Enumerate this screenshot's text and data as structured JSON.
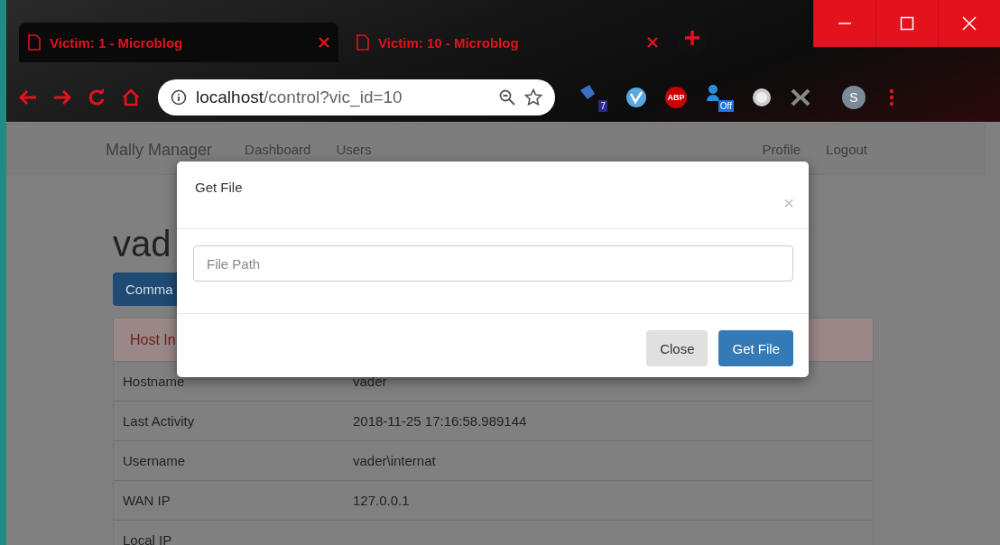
{
  "browser": {
    "tabs": [
      {
        "title": "Victim: 1 - Microblog",
        "selected": false
      },
      {
        "title": "Victim: 10 - Microblog",
        "selected": true
      }
    ],
    "url_host": "localhost",
    "url_path": "/control?vic_id=10",
    "extensions": [
      {
        "kind": "badge",
        "badge": "7"
      },
      {
        "kind": "v"
      },
      {
        "kind": "abp",
        "label": "ABP"
      },
      {
        "kind": "badge-off",
        "badge": "Off"
      },
      {
        "kind": "orb"
      },
      {
        "kind": "puzzle"
      }
    ],
    "profile_initial": "S"
  },
  "navbar": {
    "brand": "Mally Manager",
    "left_links": [
      "Dashboard",
      "Users"
    ],
    "right_links": [
      "Profile",
      "Logout"
    ]
  },
  "page": {
    "heading": "vad",
    "button": "Comma",
    "panel_heading": "Host In",
    "rows": [
      {
        "label": "Hostname",
        "value": "vader"
      },
      {
        "label": "Last Activity",
        "value": "2018-11-25 17:16:58.989144"
      },
      {
        "label": "Username",
        "value": "vader\\internat"
      },
      {
        "label": "WAN IP",
        "value": "127.0.0.1"
      },
      {
        "label": "Local IP",
        "value": ""
      }
    ]
  },
  "modal": {
    "title": "Get File",
    "close": "×",
    "input": {
      "placeholder": "File Path"
    },
    "buttons": [
      {
        "label": "Close",
        "kind": "default"
      },
      {
        "label": "Get File",
        "kind": "primary"
      }
    ]
  }
}
